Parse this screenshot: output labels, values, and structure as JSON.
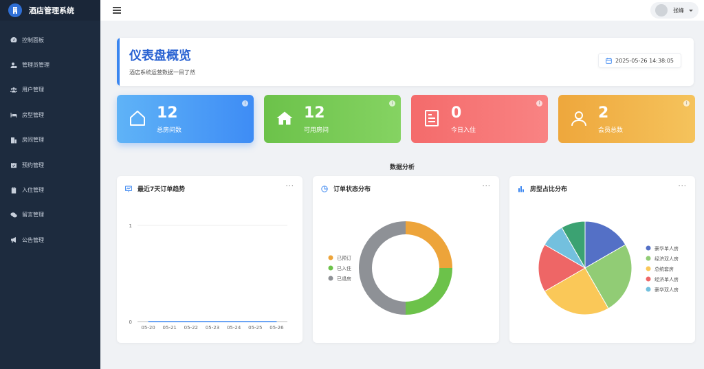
{
  "brand": {
    "title": "酒店管理系统"
  },
  "sidebar": {
    "items": [
      {
        "label": "控制面板",
        "icon": "dashboard-icon"
      },
      {
        "label": "管理员管理",
        "icon": "user-gear-icon"
      },
      {
        "label": "用户管理",
        "icon": "users-icon"
      },
      {
        "label": "房型管理",
        "icon": "bed-icon"
      },
      {
        "label": "房间管理",
        "icon": "building-icon"
      },
      {
        "label": "预约管理",
        "icon": "calendar-check-icon"
      },
      {
        "label": "入住管理",
        "icon": "clipboard-icon"
      },
      {
        "label": "留言管理",
        "icon": "comments-icon"
      },
      {
        "label": "公告管理",
        "icon": "megaphone-icon"
      }
    ]
  },
  "topbar": {
    "username": "张峰"
  },
  "header": {
    "title": "仪表盘概览",
    "subtitle": "酒店系统运营数据一目了然",
    "datetime": "2025-05-26 14:38:05"
  },
  "stats": [
    {
      "value": "12",
      "label": "总房间数",
      "icon": "house-outline-icon",
      "color_from": "#5fb3f7",
      "color_to": "#3e8cf5"
    },
    {
      "value": "12",
      "label": "可用房间",
      "icon": "home-icon",
      "color_from": "#6cc24a",
      "color_to": "#85d362"
    },
    {
      "value": "0",
      "label": "今日入住",
      "icon": "document-icon",
      "color_from": "#f46b6b",
      "color_to": "#f98383"
    },
    {
      "value": "2",
      "label": "会员总数",
      "icon": "user-icon",
      "color_from": "#eea73c",
      "color_to": "#f5c35c"
    }
  ],
  "section_title": "数据分析",
  "panels": {
    "trend": {
      "title": "最近7天订单趋势",
      "icon": "chart-line-icon"
    },
    "status": {
      "title": "订单状态分布",
      "icon": "chart-pie-icon"
    },
    "roomtype": {
      "title": "房型占比分布",
      "icon": "chart-bar-icon"
    }
  },
  "chart_data": [
    {
      "type": "line",
      "categories": [
        "05-20",
        "05-21",
        "05-22",
        "05-23",
        "05-24",
        "05-25",
        "05-26"
      ],
      "series": [
        {
          "values": [
            0,
            0,
            0,
            0,
            0,
            0,
            0
          ]
        }
      ],
      "ylim": [
        0,
        1
      ],
      "yticks": [
        "0",
        "1"
      ]
    },
    {
      "type": "pie",
      "style": "donut",
      "legend": "left",
      "slices": [
        {
          "label": "已预订",
          "value": 1,
          "color": "#eda43a"
        },
        {
          "label": "已入住",
          "value": 1,
          "color": "#6cc24a"
        },
        {
          "label": "已退房",
          "value": 2,
          "color": "#8e9196"
        }
      ]
    },
    {
      "type": "pie",
      "legend": "right",
      "slices": [
        {
          "label": "豪华单人房",
          "value": 2,
          "color": "#5470c6"
        },
        {
          "label": "经济双人房",
          "value": 3,
          "color": "#91cc75"
        },
        {
          "label": "总统套房",
          "value": 3,
          "color": "#fac858"
        },
        {
          "label": "经济单人房",
          "value": 2,
          "color": "#ee6666"
        },
        {
          "label": "豪华双人房",
          "value": 1,
          "color": "#73c0de"
        },
        {
          "label": "",
          "value": 1,
          "color": "#3ba272"
        }
      ]
    }
  ]
}
